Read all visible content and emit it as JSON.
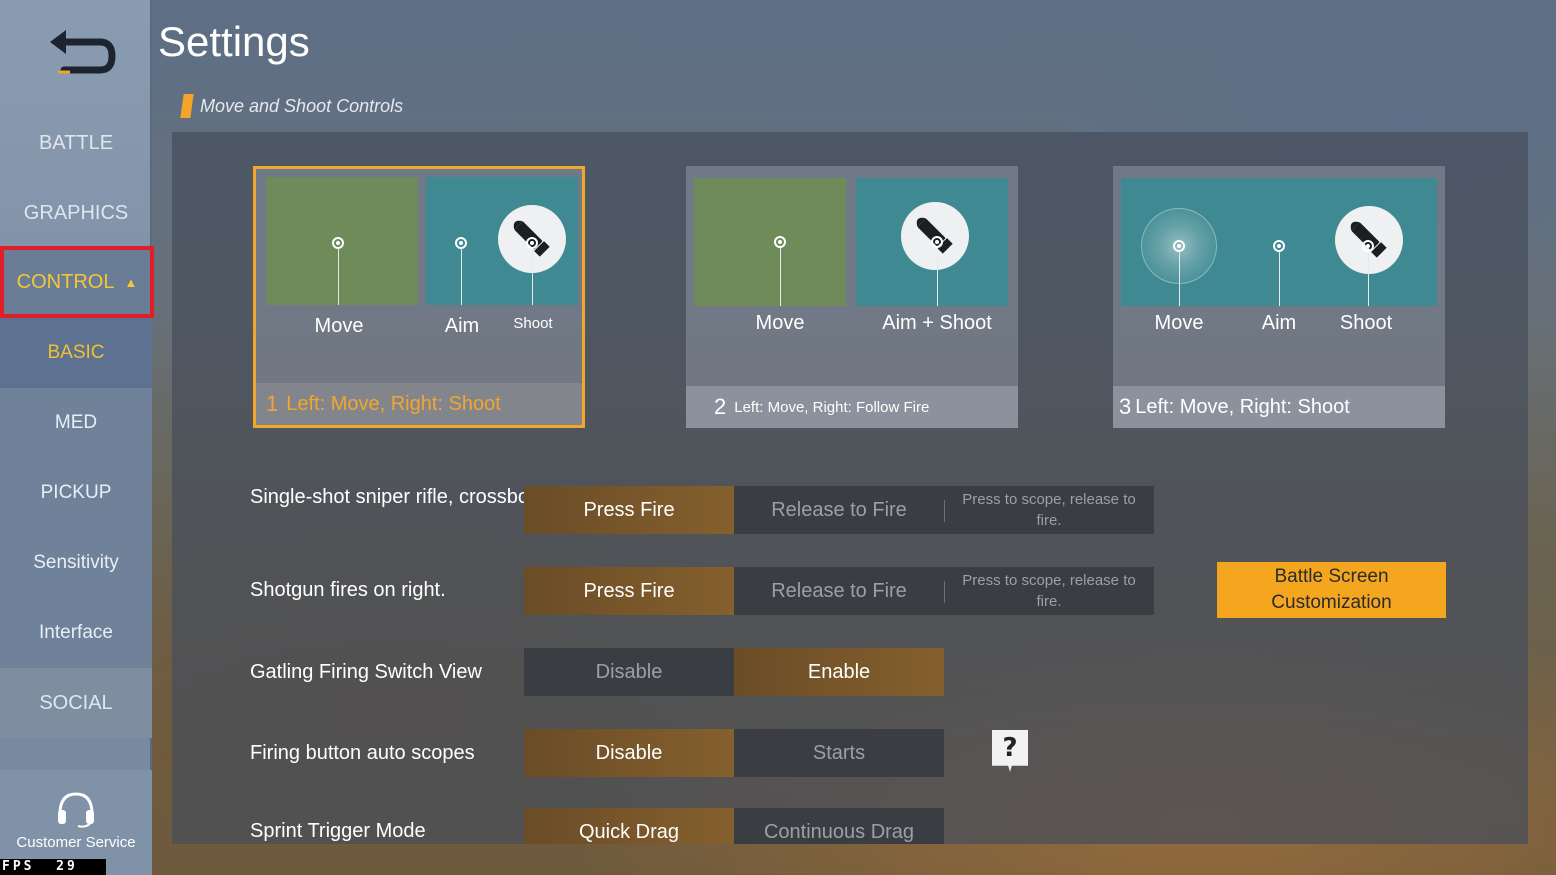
{
  "header": {
    "title": "Settings",
    "section": "Move and Shoot Controls"
  },
  "sidebar": {
    "items": [
      {
        "label": "BATTLE"
      },
      {
        "label": "GRAPHICS"
      },
      {
        "label": "CONTROL"
      },
      {
        "label": "BASIC"
      },
      {
        "label": "MED"
      },
      {
        "label": "PICKUP"
      },
      {
        "label": "Sensitivity"
      },
      {
        "label": "Interface"
      },
      {
        "label": "SOCIAL"
      }
    ],
    "active": "CONTROL",
    "active_sub": "BASIC",
    "customer_service": "Customer Service",
    "fps_label": "FPS",
    "fps_value": "29"
  },
  "layouts": [
    {
      "num": "1",
      "title": "Left: Move, Right: Shoot",
      "selected": true,
      "labels": [
        "Move",
        "Aim",
        "Shoot"
      ]
    },
    {
      "num": "2",
      "title": "Left: Move, Right: Follow Fire",
      "selected": false,
      "labels": [
        "Move",
        "Aim + Shoot"
      ]
    },
    {
      "num": "3",
      "title": "Left: Move, Right: Shoot",
      "selected": false,
      "labels": [
        "Move",
        "Aim",
        "Shoot"
      ]
    }
  ],
  "settings": [
    {
      "label": "Single-shot sniper rifle, crossbow fires on right.",
      "options": [
        "Press Fire",
        "Release to Fire",
        "Press to scope, release to fire."
      ],
      "selected": "Press Fire"
    },
    {
      "label": "Shotgun fires on right.",
      "options": [
        "Press Fire",
        "Release to Fire",
        "Press to scope, release to fire."
      ],
      "selected": "Press Fire"
    },
    {
      "label": "Gatling Firing Switch View",
      "options": [
        "Disable",
        "Enable"
      ],
      "selected": "Enable"
    },
    {
      "label": "Firing button auto scopes",
      "options": [
        "Disable",
        "Starts"
      ],
      "selected": "Disable"
    },
    {
      "label": "Sprint Trigger Mode",
      "options": [
        "Quick Drag",
        "Continuous Drag"
      ],
      "selected": "Quick Drag"
    }
  ],
  "battle_screen_button": "Battle Screen Customization",
  "help_button": "?",
  "colors": {
    "accent": "#f4a61e",
    "selected_outline": "#e01e2a",
    "option_on": "#85602e",
    "option_off": "#3a3d42"
  }
}
